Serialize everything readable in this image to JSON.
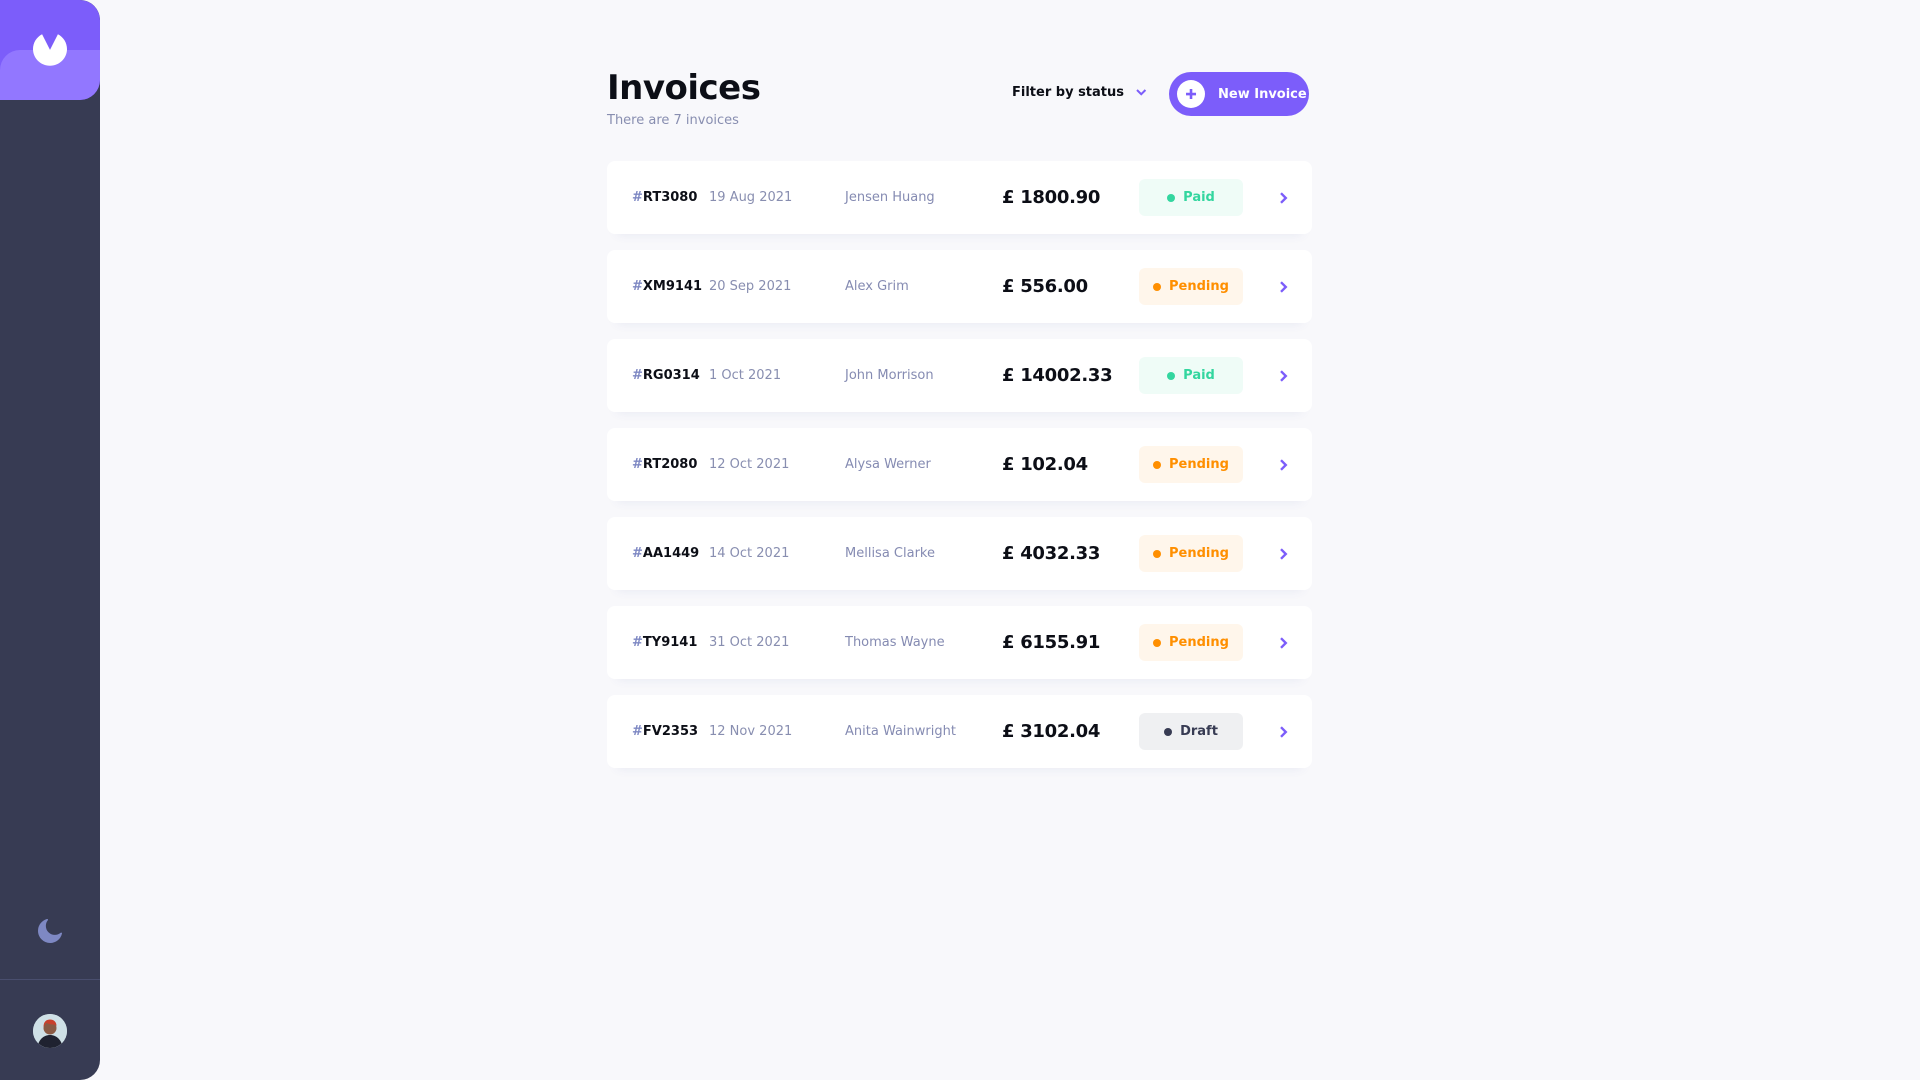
{
  "sidebar": {
    "logo": "logo-icon",
    "theme_icon": "moon-icon",
    "avatar": "user-avatar"
  },
  "header": {
    "title": "Invoices",
    "subtitle": "There are 7 invoices",
    "filter_label": "Filter by status",
    "new_invoice_label": "New Invoice"
  },
  "colors": {
    "accent": "#7c5dfa",
    "sidebar": "#373b53",
    "paid": "#33d69f",
    "pending": "#ff8f00",
    "draft": "#373b53"
  },
  "invoices": [
    {
      "hash": "#",
      "id": "RT3080",
      "date": "19 Aug 2021",
      "client": "Jensen Huang",
      "amount": "£ 1800.90",
      "status": "Paid",
      "status_key": "paid"
    },
    {
      "hash": "#",
      "id": "XM9141",
      "date": "20 Sep 2021",
      "client": "Alex Grim",
      "amount": "£ 556.00",
      "status": "Pending",
      "status_key": "pending"
    },
    {
      "hash": "#",
      "id": "RG0314",
      "date": "1 Oct 2021",
      "client": "John Morrison",
      "amount": "£ 14002.33",
      "status": "Paid",
      "status_key": "paid"
    },
    {
      "hash": "#",
      "id": "RT2080",
      "date": "12 Oct 2021",
      "client": "Alysa Werner",
      "amount": "£ 102.04",
      "status": "Pending",
      "status_key": "pending"
    },
    {
      "hash": "#",
      "id": "AA1449",
      "date": "14 Oct 2021",
      "client": "Mellisa Clarke",
      "amount": "£ 4032.33",
      "status": "Pending",
      "status_key": "pending"
    },
    {
      "hash": "#",
      "id": "TY9141",
      "date": "31 Oct 2021",
      "client": "Thomas Wayne",
      "amount": "£ 6155.91",
      "status": "Pending",
      "status_key": "pending"
    },
    {
      "hash": "#",
      "id": "FV2353",
      "date": "12 Nov 2021",
      "client": "Anita Wainwright",
      "amount": "£ 3102.04",
      "status": "Draft",
      "status_key": "draft"
    }
  ]
}
